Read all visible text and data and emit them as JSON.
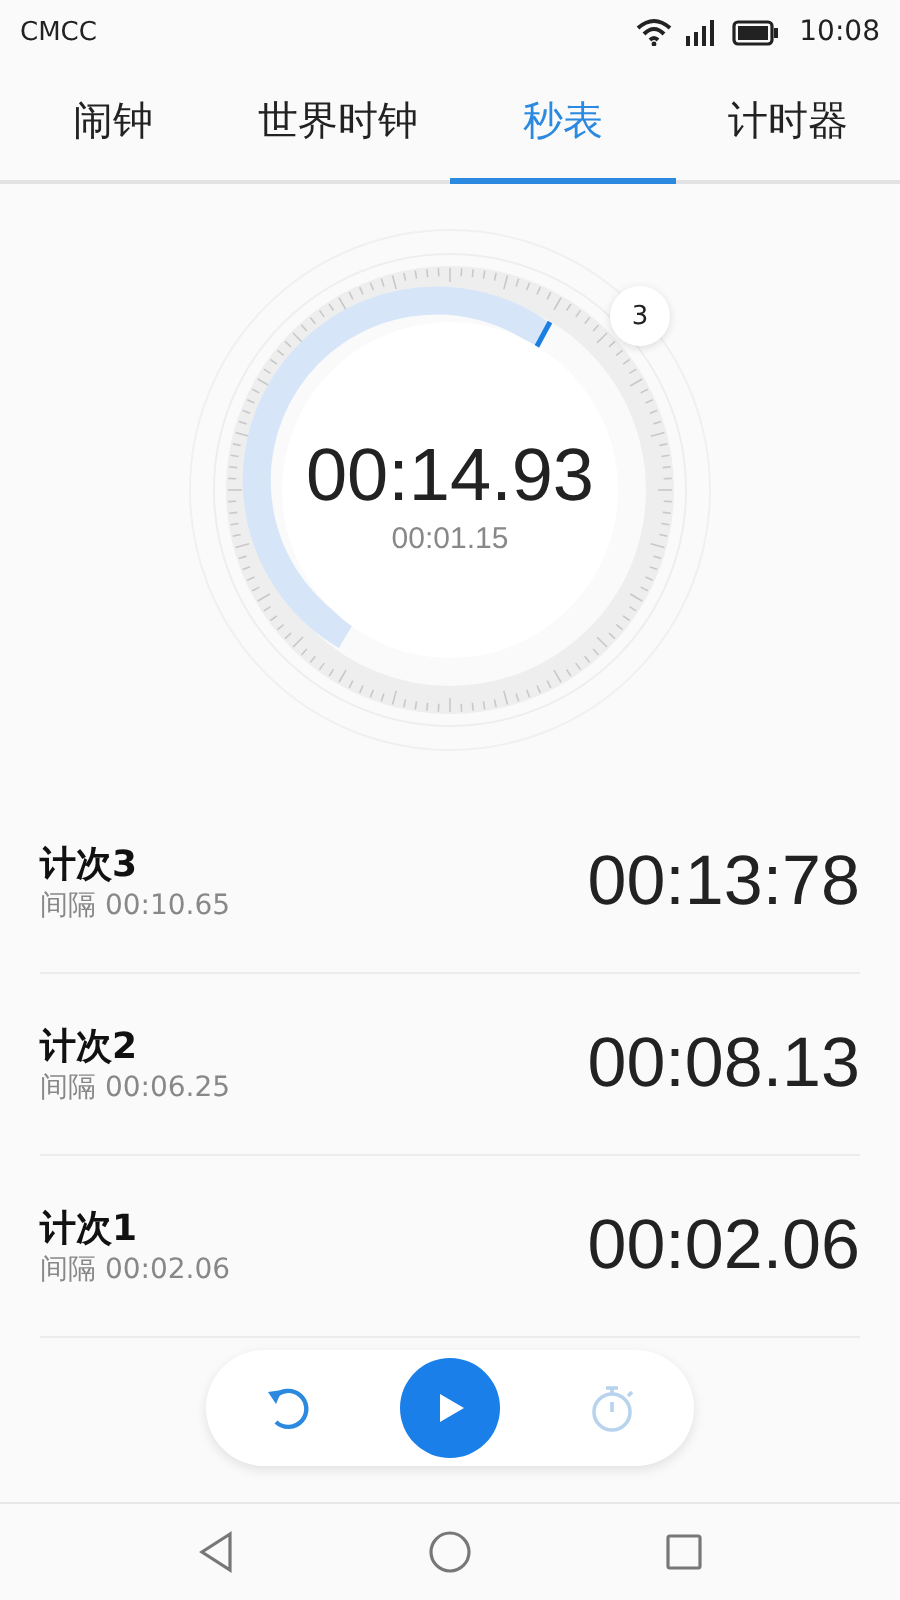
{
  "status_bar": {
    "carrier": "CMCC",
    "time": "10:08"
  },
  "tabs": [
    {
      "label": "闹钟",
      "selected": false
    },
    {
      "label": "世界时钟",
      "selected": false
    },
    {
      "label": "秒表",
      "selected": true
    },
    {
      "label": "计时器",
      "selected": false
    }
  ],
  "stopwatch": {
    "lap_count": "3",
    "total": "00:14.93",
    "current_lap": "00:01.15"
  },
  "laps": [
    {
      "name": "计次3",
      "interval": "间隔 00:10.65",
      "time": "00:13:78"
    },
    {
      "name": "计次2",
      "interval": "间隔 00:06.25",
      "time": "00:08.13"
    },
    {
      "name": "计次1",
      "interval": "间隔 00:02.06",
      "time": "00:02.06"
    }
  ],
  "controls": [
    {
      "kind": "reset",
      "disabled": false
    },
    {
      "kind": "start",
      "disabled": false
    },
    {
      "kind": "lap",
      "disabled": true
    }
  ]
}
